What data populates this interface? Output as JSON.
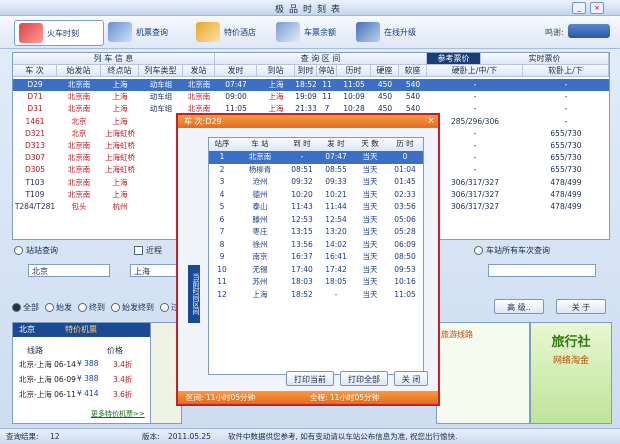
{
  "window": {
    "title": "极品时刻表",
    "min": "_",
    "close": "×"
  },
  "toolbar": {
    "items": [
      {
        "label": "火车时刻"
      },
      {
        "label": "机票查询"
      },
      {
        "label": "特价酒店"
      },
      {
        "label": "车票余额"
      },
      {
        "label": "在线升级"
      }
    ],
    "brand": "鸣谢:"
  },
  "grid": {
    "group_headers": {
      "train_info": "列 车 信 息",
      "query_range": "查 询 区 间",
      "ref_price": "参考票价",
      "live_price": "实时票价"
    },
    "columns": [
      "车 次",
      "始发站",
      "终点站",
      "列车类型",
      "发站",
      "发时",
      "到站",
      "到时",
      "停站",
      "历时",
      "硬座",
      "软座",
      "硬卧上/中/下",
      "软卧上/下"
    ],
    "rows": [
      [
        "D29",
        "北京南",
        "上海",
        "动车组",
        "北京南",
        "07:47",
        "上海",
        "18:52",
        "11",
        "11:05",
        "450",
        "540",
        "-",
        "-"
      ],
      [
        "D71",
        "北京南",
        "上海",
        "动车组",
        "北京南",
        "09:00",
        "上海",
        "19:09",
        "11",
        "10:09",
        "450",
        "540",
        "-",
        "-"
      ],
      [
        "D31",
        "北京南",
        "上海",
        "动车组",
        "北京南",
        "11:05",
        "上海",
        "21:33",
        "7",
        "10:28",
        "450",
        "540",
        "-",
        "-"
      ],
      [
        "1461",
        "北京",
        "上海",
        "",
        "",
        "",
        "",
        "",
        "",
        "",
        "",
        "",
        "285/296/306",
        "-"
      ],
      [
        "D321",
        "北京",
        "上海虹桥",
        "",
        "",
        "",
        "",
        "",
        "",
        "",
        "",
        "",
        "-",
        "655/730"
      ],
      [
        "D313",
        "北京南",
        "上海虹桥",
        "",
        "",
        "",
        "",
        "",
        "",
        "",
        "",
        "",
        "-",
        "655/730"
      ],
      [
        "D307",
        "北京南",
        "上海虹桥",
        "",
        "",
        "",
        "",
        "",
        "",
        "",
        "",
        "",
        "-",
        "655/730"
      ],
      [
        "D305",
        "北京南",
        "上海虹桥",
        "",
        "",
        "",
        "",
        "",
        "",
        "",
        "",
        "",
        "-",
        "655/730"
      ],
      [
        "T103",
        "北京南",
        "上海",
        "",
        "",
        "",
        "",
        "",
        "",
        "",
        "",
        "",
        "306/317/327",
        "478/499"
      ],
      [
        "T109",
        "北京南",
        "上海",
        "",
        "",
        "",
        "",
        "",
        "",
        "",
        "",
        "",
        "306/317/327",
        "478/499"
      ],
      [
        "T284/T281",
        "包头",
        "杭州",
        "",
        "",
        "",
        "",
        "",
        "",
        "",
        "",
        "",
        "306/317/327",
        "478/499"
      ]
    ]
  },
  "search": {
    "station_query": "站站查询",
    "nearby": "近程",
    "from": "北京",
    "to": "上海",
    "station_all": "车站所有车次查询",
    "filters": [
      "全部",
      "始发",
      "终到",
      "始发终到",
      "过路"
    ],
    "advanced_button": "高 级..",
    "close_button": "关 于"
  },
  "popup": {
    "title": "车 次:D29",
    "side_label": "当前时间区间",
    "columns": [
      "站序",
      "车 站",
      "到 时",
      "发 时",
      "天 数",
      "历 时"
    ],
    "rows": [
      [
        "1",
        "北京南",
        "-",
        "07:47",
        "当天",
        "0"
      ],
      [
        "2",
        "杨柳青",
        "08:51",
        "08:55",
        "当天",
        "01:04"
      ],
      [
        "3",
        "沧州",
        "09:32",
        "09:33",
        "当天",
        "01:45"
      ],
      [
        "4",
        "德州",
        "10:20",
        "10:21",
        "当天",
        "02:33"
      ],
      [
        "5",
        "泰山",
        "11:43",
        "11:44",
        "当天",
        "03:56"
      ],
      [
        "6",
        "滕州",
        "12:53",
        "12:54",
        "当天",
        "05:06"
      ],
      [
        "7",
        "枣庄",
        "13:15",
        "13:20",
        "当天",
        "05:28"
      ],
      [
        "8",
        "徐州",
        "13:56",
        "14:02",
        "当天",
        "06:09"
      ],
      [
        "9",
        "南京",
        "16:37",
        "16:41",
        "当天",
        "08:50"
      ],
      [
        "10",
        "无锡",
        "17:40",
        "17:42",
        "当天",
        "09:53"
      ],
      [
        "11",
        "苏州",
        "18:03",
        "18:05",
        "当天",
        "10:16"
      ],
      [
        "12",
        "上海",
        "18:52",
        "-",
        "当天",
        "11:05"
      ]
    ],
    "buttons": {
      "print_current": "打印当前",
      "print_all": "打印全部",
      "close": "关 闭"
    },
    "status_left": "区间: 11小时05分钟",
    "status_right": "全程: 11小时05分钟"
  },
  "promo": {
    "city": "北京",
    "title": "特价机票",
    "col_route": "线路",
    "col_price": "价格",
    "rows": [
      {
        "route": "北京-上海 06-14",
        "price": "¥ 388",
        "disc": "3.4折"
      },
      {
        "route": "北京-上海 06-09",
        "price": "¥ 388",
        "disc": "3.4折"
      },
      {
        "route": "北京-上海 06-11",
        "price": "¥ 414",
        "disc": "3.6折"
      }
    ],
    "more": "更多特价机票>>",
    "right_title": "旅行社",
    "right_sub": "网络淘金",
    "right_link": "旅游线路"
  },
  "status": {
    "result_label": "查询结果:",
    "result_count": "12",
    "version_label": "版本:",
    "version": "2011.05.25",
    "notice": "软件中数据供您参考, 如有变动请以车站公布信息为准, 祝您出行愉快."
  }
}
